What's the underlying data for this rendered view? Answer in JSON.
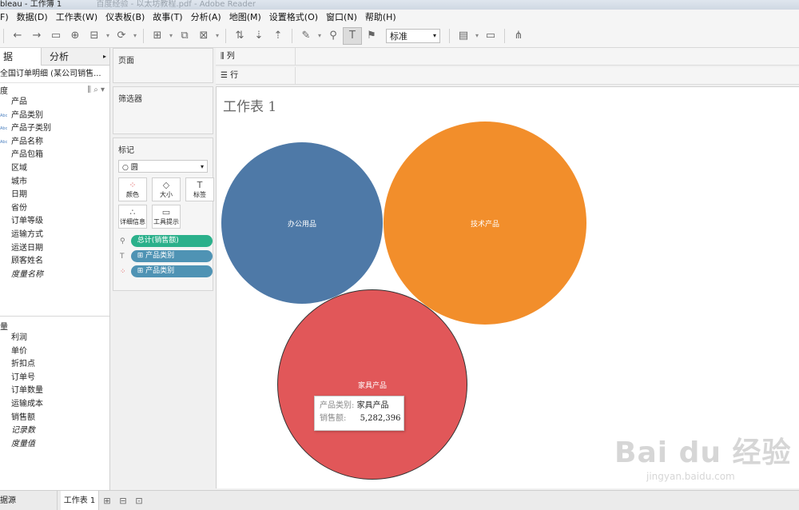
{
  "window": {
    "title": "bleau - 工作簿 1",
    "ghost_title": "百度经验 - 以太坊教程.pdf - Adobe Reader"
  },
  "menu": [
    "F)",
    "数据(D)",
    "工作表(W)",
    "仪表板(B)",
    "故事(T)",
    "分析(A)",
    "地图(M)",
    "设置格式(O)",
    "窗口(N)",
    "帮助(H)"
  ],
  "toolbar": {
    "fit_value": "标准"
  },
  "data_pane": {
    "tab_data": "据",
    "tab_analysis": "分析",
    "datasource": "全国订单明细 (某公司销售...",
    "dimensions_header": "度",
    "dimensions": [
      {
        "label": "产品",
        "icon": ""
      },
      {
        "label": "产品类别",
        "icon": "Abc"
      },
      {
        "label": "产品子类别",
        "icon": "Abc"
      },
      {
        "label": "产品名称",
        "icon": "Abc"
      },
      {
        "label": "产品包箱",
        "icon": ""
      },
      {
        "label": "区域",
        "icon": ""
      },
      {
        "label": "城市",
        "icon": ""
      },
      {
        "label": "日期",
        "icon": ""
      },
      {
        "label": "省份",
        "icon": ""
      },
      {
        "label": "订单等级",
        "icon": ""
      },
      {
        "label": "运输方式",
        "icon": ""
      },
      {
        "label": "运送日期",
        "icon": ""
      },
      {
        "label": "顾客姓名",
        "icon": ""
      },
      {
        "label": "度量名称",
        "icon": "",
        "italic": true
      }
    ],
    "measures_header": "量",
    "measures": [
      {
        "label": "利润"
      },
      {
        "label": "单价"
      },
      {
        "label": "折扣点"
      },
      {
        "label": "订单号"
      },
      {
        "label": "订单数量"
      },
      {
        "label": "运输成本"
      },
      {
        "label": "销售额"
      },
      {
        "label": "记录数",
        "italic": true
      },
      {
        "label": "度量值",
        "italic": true
      }
    ]
  },
  "cards": {
    "pages": "页面",
    "filters": "筛选器",
    "marks": "标记",
    "mark_type": "圆",
    "buttons": [
      {
        "label": "颜色",
        "icon": "color-icon"
      },
      {
        "label": "大小",
        "icon": "size-icon"
      },
      {
        "label": "标签",
        "icon": "label-icon"
      },
      {
        "label": "详细信息",
        "icon": "detail-icon"
      },
      {
        "label": "工具提示",
        "icon": "tooltip-icon"
      }
    ],
    "pills": [
      {
        "label": "总计(销售额)",
        "kind": "size",
        "color": "#2bb08b"
      },
      {
        "label": "⊞ 产品类别",
        "kind": "label",
        "color": "#4f93b4"
      },
      {
        "label": "⊞ 产品类别",
        "kind": "color",
        "color": "#4f93b4"
      }
    ]
  },
  "shelves": {
    "columns": "列",
    "rows": "行"
  },
  "sheet": {
    "title": "工作表 1"
  },
  "chart_data": {
    "type": "bubble",
    "size_measure": "总计(销售额)",
    "label_dimension": "产品类别",
    "bubbles": [
      {
        "label": "办公用品",
        "color": "#4e79a7"
      },
      {
        "label": "技术产品",
        "color": "#f28e2b"
      },
      {
        "label": "家具产品",
        "color": "#e15759",
        "value": 5282396
      }
    ]
  },
  "tooltip": {
    "category_key": "产品类别:",
    "category_value": "家具产品",
    "sales_key": "销售额:",
    "sales_value": "5,282,396"
  },
  "watermark": {
    "line1": "Bai du 经验",
    "line2": "jingyan.baidu.com"
  },
  "statusbar": {
    "source": "据源",
    "sheet_tab": "工作表 1"
  }
}
